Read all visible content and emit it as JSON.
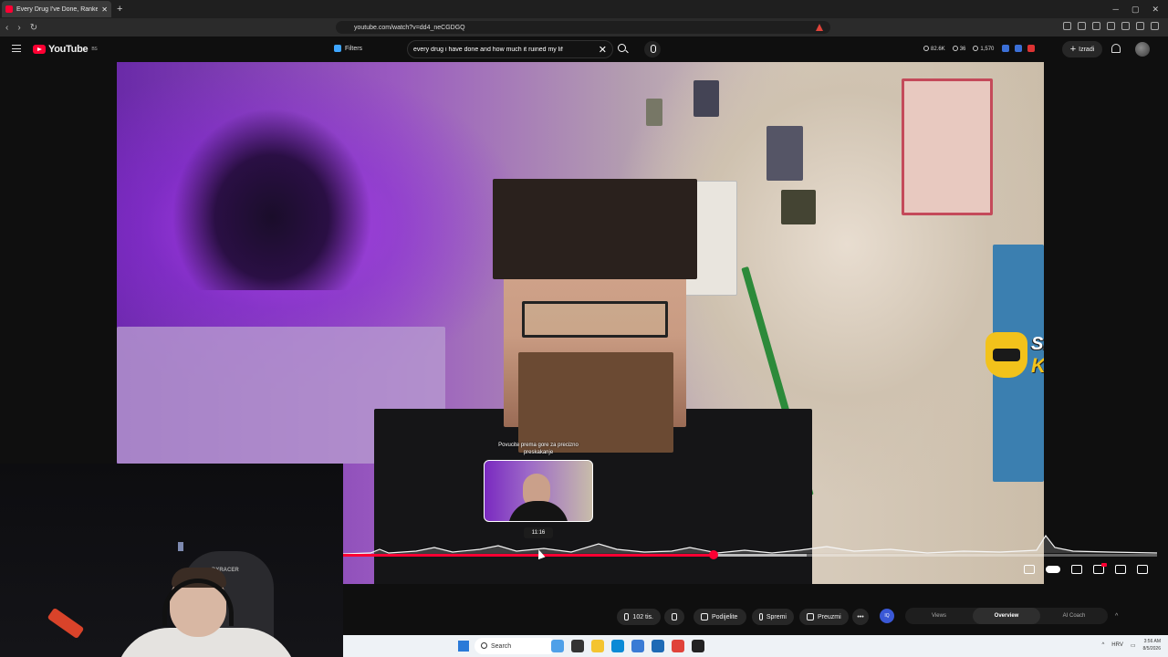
{
  "browser": {
    "tab_title": "Every Drug I've Done, Ranked b",
    "url": "youtube.com/watch?v=dd4_neCGDGQ"
  },
  "header": {
    "logo_text": "YouTube",
    "logo_region": "BS",
    "filters_label": "Filters",
    "search_query": "every drug i have done and how much it ruined my lif",
    "stats": [
      "82.6K",
      "36",
      "1,570"
    ],
    "create_label": "Izradi"
  },
  "overlay": {
    "brand_line1": "SkinsMonkey",
    "brand_line2": "KOD: LEON"
  },
  "seek_preview": {
    "hint": "Povucite prema gore za precizno preskakanje",
    "time": "11:16"
  },
  "progress": {
    "played_fraction": 0.455,
    "buffered_fraction": 0.57,
    "hover_fraction": 0.24
  },
  "webcam": {
    "chair_brand": "DXRACER"
  },
  "actions": {
    "like_count": "102 tis.",
    "share_label": "Podijelite",
    "save_label": "Spremi",
    "download_label": "Preuzmi",
    "more_label": "•••"
  },
  "side_tabs": {
    "ai_badge": "IQ",
    "tabs": [
      "Views",
      "Overview",
      "AI Coach"
    ],
    "active": "Overview"
  },
  "taskbar": {
    "search_placeholder": "Search",
    "lang": "HRV",
    "time": "3:56 AM",
    "date": "8/5/2026"
  },
  "colors": {
    "accent": "#ff0033",
    "brand_yellow": "#f2c21b"
  }
}
